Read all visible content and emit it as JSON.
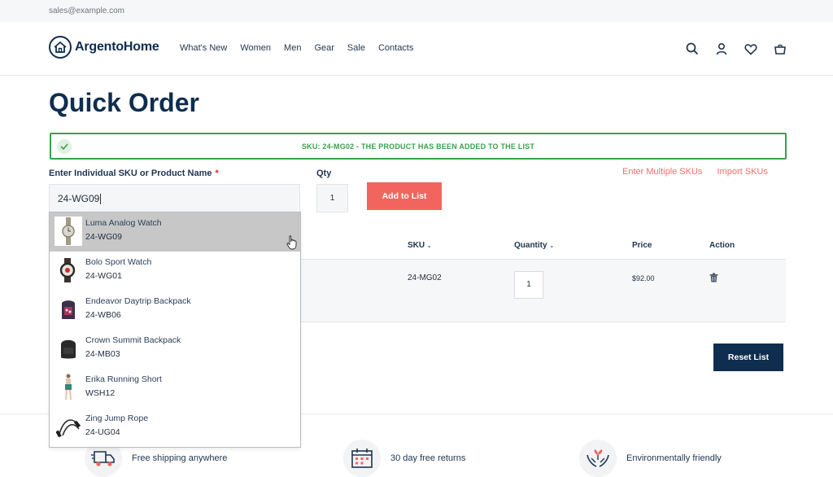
{
  "topbar": {
    "email": "sales@example.com"
  },
  "header": {
    "logo_text": "ArgentoHome",
    "nav": [
      "What's New",
      "Women",
      "Men",
      "Gear",
      "Sale",
      "Contacts"
    ],
    "icons": [
      "search-icon",
      "account-icon",
      "wishlist-icon",
      "cart-icon"
    ]
  },
  "page": {
    "title": "Quick Order"
  },
  "notice": {
    "message": "SKU: 24-MG02 - THE PRODUCT HAS BEEN ADDED TO THE LIST",
    "color": "#3aa14c"
  },
  "form": {
    "sku_label": "Enter Individual SKU or Product Name",
    "required_mark": "*",
    "sku_value": "24-WG09",
    "qty_label": "Qty",
    "qty_value": "1",
    "add_button": "Add to List",
    "link_multiple": "Enter Multiple SKUs",
    "link_import": "Import SKUs"
  },
  "table": {
    "headers": {
      "sku": "SKU",
      "quantity": "Quantity",
      "price": "Price",
      "action": "Action"
    },
    "rows": [
      {
        "sku": "24-MG02",
        "quantity": "1",
        "price": "$92.00"
      }
    ],
    "reset_button": "Reset List"
  },
  "dropdown": {
    "items": [
      {
        "name": "Luma Analog Watch",
        "sku": "24-WG09",
        "active": true
      },
      {
        "name": "Bolo Sport Watch",
        "sku": "24-WG01"
      },
      {
        "name": "Endeavor Daytrip Backpack",
        "sku": "24-WB06"
      },
      {
        "name": "Crown Summit Backpack",
        "sku": "24-MB03"
      },
      {
        "name": "Erika Running Short",
        "sku": "WSH12"
      },
      {
        "name": "Zing Jump Rope",
        "sku": "24-UG04"
      }
    ]
  },
  "features": [
    {
      "text": "Free shipping anywhere",
      "icon": "truck-icon"
    },
    {
      "text": "30 day free returns",
      "icon": "calendar-icon"
    },
    {
      "text": "Environmentally friendly",
      "icon": "hands-plant-icon"
    }
  ],
  "colors": {
    "primary": "#0f2e4f",
    "accent": "#f2655e",
    "success": "#3aa14c"
  }
}
